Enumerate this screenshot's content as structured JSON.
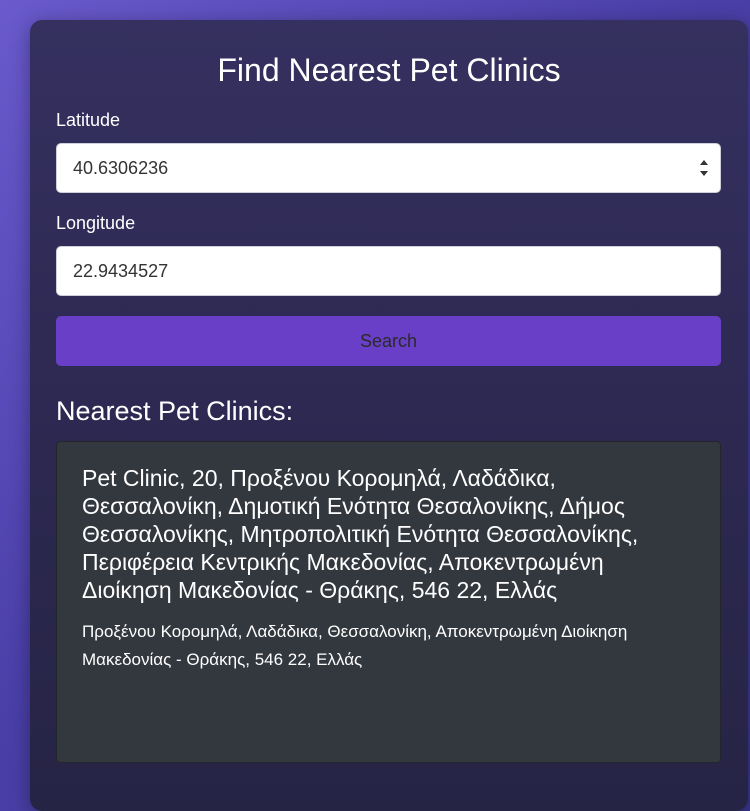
{
  "form": {
    "title": "Find Nearest Pet Clinics",
    "latitude_label": "Latitude",
    "latitude_value": "40.6306236",
    "longitude_label": "Longitude",
    "longitude_value": "22.9434527",
    "search_label": "Search"
  },
  "results": {
    "heading": "Nearest Pet Clinics:",
    "items": [
      {
        "name": "Pet Clinic, 20, Προξένου Κορομηλά, Λαδάδικα, Θεσσαλονίκη, Δημοτική Ενότητα Θεσαλονίκης, Δήμος Θεσσαλονίκης, Μητροπολιτική Ενότητα Θεσσαλονίκης, Περιφέρεια Κεντρικής Μακεδονίας, Αποκεντρωμένη Διοίκηση Μακεδονίας - Θράκης, 546 22, Ελλάς",
        "address": "Προξένου Κορομηλά, Λαδάδικα, Θεσσαλονίκη, Αποκεντρωμένη Διοίκηση Μακεδονίας - Θράκης, 546 22, Ελλάς"
      }
    ]
  },
  "colors": {
    "background": "#5a4fc0",
    "card": "#2c2850",
    "button": "#6a3fc7",
    "result_card": "#33373e"
  },
  "icons": {
    "spinner": "number-spinner-icon"
  }
}
